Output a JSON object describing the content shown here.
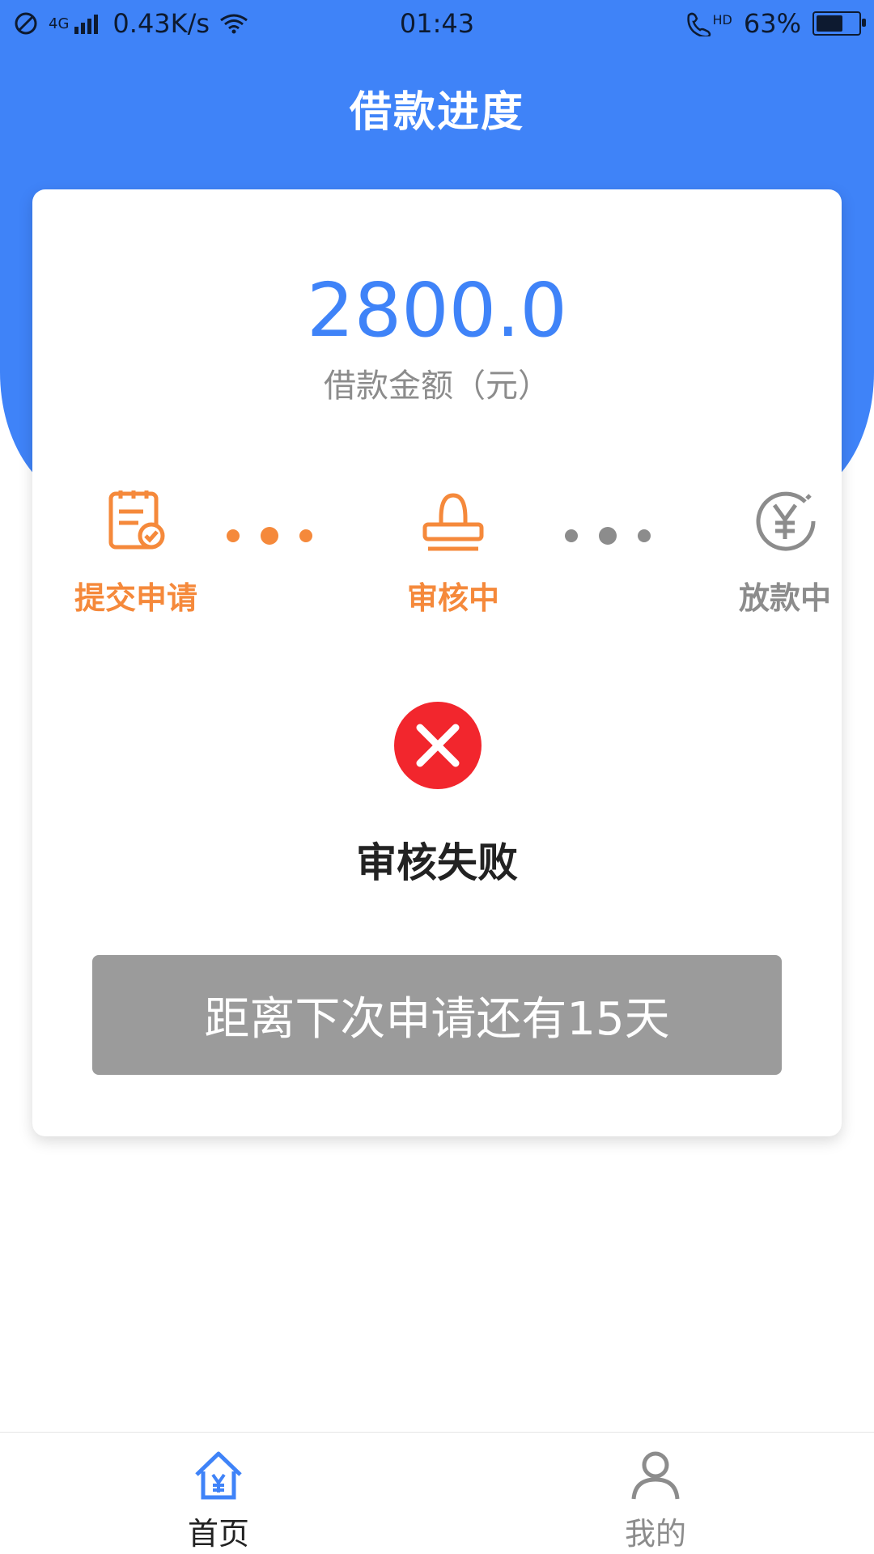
{
  "status_bar": {
    "network": "4G",
    "speed": "0.43K/s",
    "time": "01:43",
    "hd": "HD",
    "battery_level": 0.63,
    "battery_label": "63%"
  },
  "header": {
    "title": "借款进度"
  },
  "loan": {
    "amount": "2800.0",
    "amount_label": "借款金额（元）"
  },
  "steps": [
    {
      "label": "提交申请",
      "state": "done",
      "color": "#f5893b"
    },
    {
      "label": "审核中",
      "state": "current",
      "color": "#f5893b"
    },
    {
      "label": "放款中",
      "state": "pending",
      "color": "#8c8c8c"
    }
  ],
  "review": {
    "status_text": "审核失败",
    "status_color": "#f2262d",
    "next_apply_text": "距离下次申请还有15天"
  },
  "bottom_nav": {
    "home_label": "首页",
    "mine_label": "我的",
    "active_color": "#3f83f8",
    "inactive_color": "#8c8c8c"
  },
  "colors": {
    "brand_blue": "#3f83f8",
    "orange": "#f5893b",
    "gray": "#9b9b9b"
  }
}
